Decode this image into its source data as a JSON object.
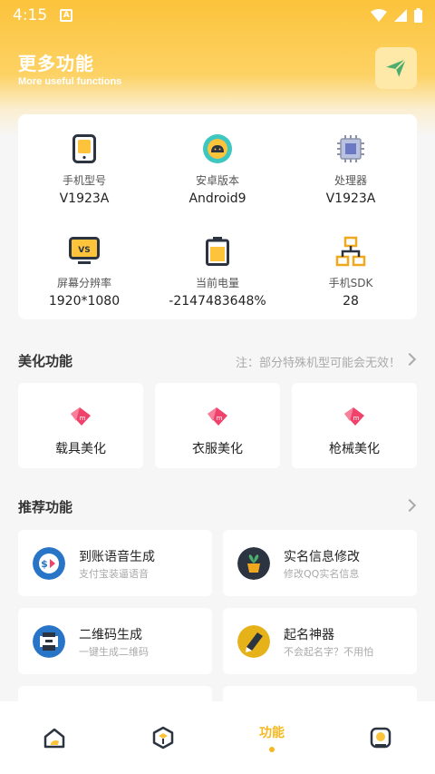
{
  "status_bar": {
    "time": "4:15",
    "app_icon": "A"
  },
  "header": {
    "title": "更多功能",
    "subtitle": "More useful functions"
  },
  "device_info": [
    {
      "icon": "phone-icon",
      "label": "手机型号",
      "value": "V1923A"
    },
    {
      "icon": "android-icon",
      "label": "安卓版本",
      "value": "Android9"
    },
    {
      "icon": "cpu-icon",
      "label": "处理器",
      "value": "V1923A"
    },
    {
      "icon": "monitor-icon",
      "label": "屏幕分辨率",
      "value": "1920*1080"
    },
    {
      "icon": "battery-icon",
      "label": "当前电量",
      "value": "-2147483648%"
    },
    {
      "icon": "network-icon",
      "label": "手机SDK",
      "value": "28"
    }
  ],
  "beauty_section": {
    "title": "美化功能",
    "note": "注：部分特殊机型可能会无效！",
    "items": [
      {
        "label": "载具美化"
      },
      {
        "label": "衣服美化"
      },
      {
        "label": "枪械美化"
      }
    ]
  },
  "recommend_section": {
    "title": "推荐功能",
    "items": [
      {
        "title": "到账语音生成",
        "subtitle": "支付宝装逼语音"
      },
      {
        "title": "实名信息修改",
        "subtitle": "修改QQ实名信息"
      },
      {
        "title": "二维码生成",
        "subtitle": "一键生成二维码"
      },
      {
        "title": "起名神器",
        "subtitle": "不会起名字？不用怕"
      }
    ]
  },
  "bottom_nav": {
    "active_label": "功能"
  },
  "colors": {
    "accent": "#f6b820",
    "header": "#fcc33b"
  }
}
